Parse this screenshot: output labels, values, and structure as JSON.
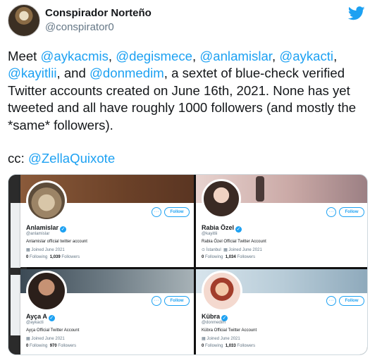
{
  "tweet": {
    "author": {
      "display_name": "Conspirador Norteño",
      "handle": "@conspirator0"
    },
    "text_segments": [
      {
        "text": "Meet ",
        "type": "text"
      },
      {
        "text": "@aykacmis",
        "type": "mention"
      },
      {
        "text": ", ",
        "type": "text"
      },
      {
        "text": "@degismece",
        "type": "mention"
      },
      {
        "text": ", ",
        "type": "text"
      },
      {
        "text": "@anlamislar",
        "type": "mention"
      },
      {
        "text": ", ",
        "type": "text"
      },
      {
        "text": "@aykacti",
        "type": "mention"
      },
      {
        "text": ", ",
        "type": "text"
      },
      {
        "text": "@kayitlii",
        "type": "mention"
      },
      {
        "text": ", and ",
        "type": "text"
      },
      {
        "text": "@donmedim",
        "type": "mention"
      },
      {
        "text": ", a sextet of blue-check verified Twitter accounts created on June 16th, 2021. None has yet tweeted and all have roughly 1000 followers (and mostly the *same* followers).",
        "type": "text"
      }
    ],
    "cc_label": "cc: ",
    "cc_mention": "@ZellaQuixote"
  },
  "cards": [
    {
      "name": "Anlamislar",
      "username": "@anlamislar",
      "bio": "Anlamislar official twitter account",
      "location": "",
      "joined": "Joined June 2021",
      "following_count": "0",
      "following_label": "Following",
      "followers_count": "1,039",
      "followers_label": "Followers",
      "follow_label": "Follow",
      "more_label": "···",
      "verified_mark": "✓"
    },
    {
      "name": "Rabia Özel",
      "username": "@kayitlii",
      "bio": "Rabia  Özel Official Twitter Account",
      "location": "İstanbul",
      "joined": "Joined June 2021",
      "following_count": "0",
      "following_label": "Following",
      "followers_count": "1,034",
      "followers_label": "Followers",
      "follow_label": "Follow",
      "more_label": "···",
      "verified_mark": "✓"
    },
    {
      "name": "Ayça A",
      "username": "@aykacti",
      "bio": "Ayça Official Twitter Account",
      "location": "",
      "joined": "Joined June 2021",
      "following_count": "0",
      "following_label": "Following",
      "followers_count": "970",
      "followers_label": "Followers",
      "follow_label": "Follow",
      "more_label": "···",
      "verified_mark": "✓"
    },
    {
      "name": "Kübra",
      "username": "@donmedim",
      "bio": "Kübra Official Twitter Account",
      "location": "",
      "joined": "Joined June 2021",
      "following_count": "0",
      "following_label": "Following",
      "followers_count": "1,033",
      "followers_label": "Followers",
      "follow_label": "Follow",
      "more_label": "···",
      "verified_mark": "✓"
    }
  ],
  "colors": {
    "twitter_blue": "#1da1f2",
    "text": "#14171a",
    "secondary_text": "#657786"
  },
  "icons": {
    "brand": "twitter-bird-icon",
    "calendar": "calendar-icon",
    "location": "location-pin-icon",
    "verified": "verified-badge-icon"
  }
}
